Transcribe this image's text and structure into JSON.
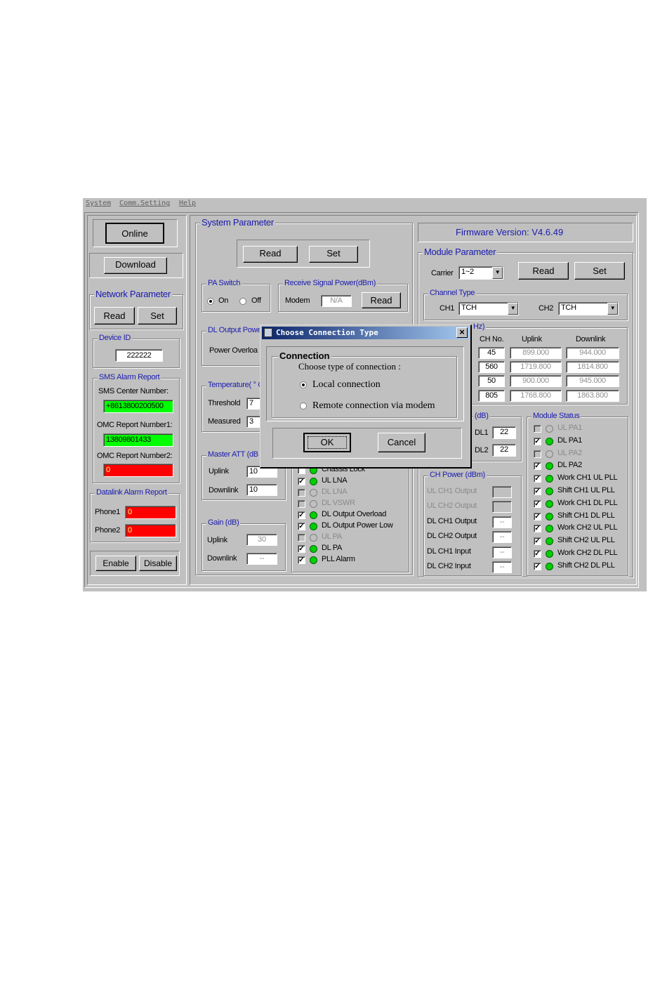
{
  "menu": [
    "System",
    "Comm.Setting",
    "Help"
  ],
  "left": {
    "online": "Online",
    "download": "Download",
    "network_parameter": {
      "title": "Network Parameter",
      "read": "Read",
      "set": "Set"
    },
    "device_id": {
      "title": "Device ID",
      "value": "222222"
    },
    "sms": {
      "title": "SMS Alarm Report",
      "center_label": "SMS Center Number:",
      "center_value": "+8613800200500",
      "omc1_label": "OMC Report Number1:",
      "omc1_value": "13809801433",
      "omc2_label": "OMC Report Number2:",
      "omc2_value": "0"
    },
    "datalink": {
      "title": "Datalink Alarm Report",
      "phone1_label": "Phone1",
      "phone1_value": "0",
      "phone2_label": "Phone2",
      "phone2_value": "0"
    },
    "enable": "Enable",
    "disable": "Disable"
  },
  "system_parameter": {
    "title": "System Parameter",
    "read": "Read",
    "set": "Set",
    "pa_switch": {
      "title": "PA Switch",
      "on": "On",
      "off": "Off"
    },
    "receive_signal": {
      "title": "Receive Signal Power(dBm)",
      "modem_label": "Modem",
      "modem_value": "N/A",
      "read": "Read"
    },
    "dl_output": {
      "title": "DL Output Powe",
      "overload_label": "Power Overloa"
    },
    "temperature": {
      "title": "Temperature( ° C",
      "threshold_label": "Threshold",
      "threshold_value": "7",
      "measured_label": "Measured",
      "measured_value": "3"
    },
    "master_att": {
      "title": "Master ATT (dB",
      "uplink_label": "Uplink",
      "uplink_value": "10",
      "downlink_label": "Downlink",
      "downlink_value": "10"
    },
    "gain": {
      "title": "Gain (dB)",
      "uplink_label": "Uplink",
      "uplink_value": "30",
      "downlink_label": "Downlink",
      "downlink_value": "--"
    },
    "alarms": [
      {
        "label": "Chassis Lock",
        "checked": false,
        "active": true
      },
      {
        "label": "UL LNA",
        "checked": true,
        "active": true
      },
      {
        "label": "DL LNA",
        "checked": false,
        "active": false
      },
      {
        "label": "DL VSWR",
        "checked": false,
        "active": false
      },
      {
        "label": "DL Output Overload",
        "checked": true,
        "active": true
      },
      {
        "label": "DL Output Power Low",
        "checked": true,
        "active": true
      },
      {
        "label": "UL PA",
        "checked": false,
        "active": false
      },
      {
        "label": "DL PA",
        "checked": true,
        "active": true
      },
      {
        "label": "PLL Alarm",
        "checked": true,
        "active": true
      }
    ]
  },
  "right": {
    "firmware": "Firmware Version: V4.6.49",
    "module_parameter": {
      "title": "Module Parameter",
      "carrier_label": "Carrier",
      "carrier_value": "1~2",
      "read": "Read",
      "set": "Set"
    },
    "channel_type": {
      "title": "Channel Type",
      "ch1_label": "CH1",
      "ch1_value": "TCH",
      "ch2_label": "CH2",
      "ch2_value": "TCH"
    },
    "frequency": {
      "title": "Hz)",
      "headers": [
        "CH No.",
        "Uplink",
        "Downlink"
      ],
      "rows": [
        {
          "ch": "45",
          "up": "899.000",
          "down": "944.000"
        },
        {
          "ch": "560",
          "up": "1719.800",
          "down": "1814.800"
        },
        {
          "ch": "50",
          "up": "900.000",
          "down": "945.000"
        },
        {
          "ch": "805",
          "up": "1768.800",
          "down": "1863.800"
        }
      ]
    },
    "att": {
      "title": "(dB)",
      "dl1_label": "DL1",
      "dl1_value": "22",
      "dl2_label": "DL2",
      "dl2_value": "22"
    },
    "ch_power": {
      "title": "CH Power (dBm)",
      "rows": [
        {
          "label": "UL CH1 Output",
          "value": "",
          "enabled": false
        },
        {
          "label": "UL CH2 Output",
          "value": "",
          "enabled": false
        },
        {
          "label": "DL CH1 Output",
          "value": "--",
          "enabled": true
        },
        {
          "label": "DL CH2 Output",
          "value": "--",
          "enabled": true
        },
        {
          "label": "DL CH1 Input",
          "value": "--",
          "enabled": true
        },
        {
          "label": "DL CH2 Input",
          "value": "--",
          "enabled": true
        }
      ]
    },
    "module_status": {
      "title": "Module Status",
      "items": [
        {
          "label": "UL PA1",
          "checked": false,
          "active": false
        },
        {
          "label": "DL PA1",
          "checked": true,
          "active": true
        },
        {
          "label": "UL PA2",
          "checked": false,
          "active": false
        },
        {
          "label": "DL PA2",
          "checked": true,
          "active": true
        },
        {
          "label": "Work CH1 UL PLL",
          "checked": true,
          "active": true
        },
        {
          "label": "Shift CH1 UL PLL",
          "checked": true,
          "active": true
        },
        {
          "label": "Work CH1 DL PLL",
          "checked": true,
          "active": true
        },
        {
          "label": "Shift CH1 DL PLL",
          "checked": true,
          "active": true
        },
        {
          "label": "Work CH2 UL PLL",
          "checked": true,
          "active": true
        },
        {
          "label": "Shift CH2 UL PLL",
          "checked": true,
          "active": true
        },
        {
          "label": "Work CH2 DL PLL",
          "checked": true,
          "active": true
        },
        {
          "label": "Shift CH2 DL PLL",
          "checked": true,
          "active": true
        }
      ]
    }
  },
  "dialog": {
    "title": "Choose Connection Type",
    "close": "×",
    "group": "Connection",
    "prompt": "Choose type of connection :",
    "local": "Local connection",
    "remote": "Remote connection via modem",
    "ok": "OK",
    "cancel": "Cancel"
  },
  "colors": {
    "label_blue": "#1a1ab0",
    "face": "#c0c0c0",
    "green_field": "#00ff00",
    "red_field": "#ff0000"
  }
}
